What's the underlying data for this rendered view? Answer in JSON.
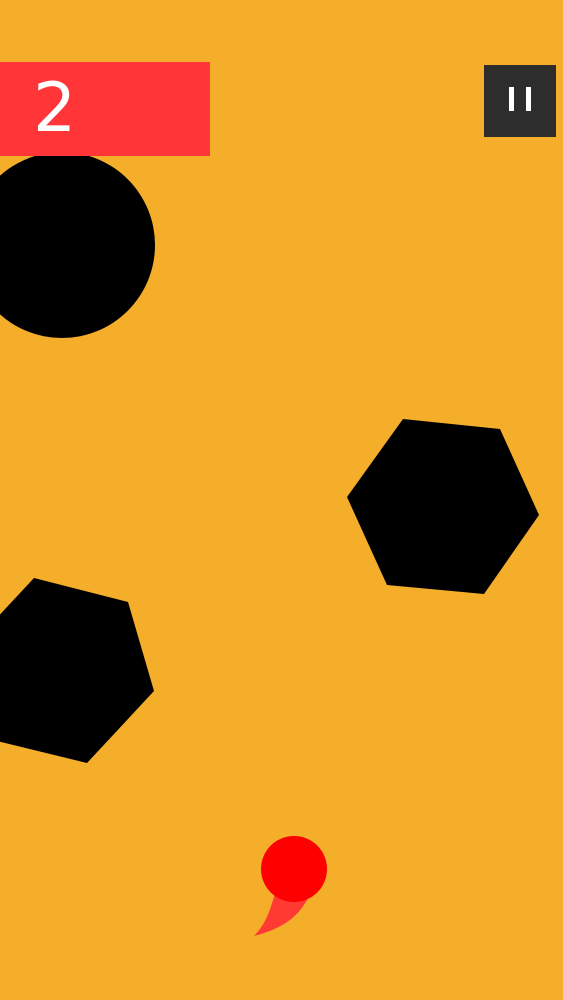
{
  "game": {
    "background_color": "#F4AE2A",
    "obstacle_color": "#000000"
  },
  "hud": {
    "score": "2",
    "score_panel_color": "#FF3537",
    "pause_button": {
      "icon": "pause-icon",
      "color": "#2D2D2D"
    }
  },
  "player": {
    "color": "#FF0000",
    "trail_color": "#FF3A33"
  },
  "obstacles": [
    {
      "shape": "circle"
    },
    {
      "shape": "hexagon"
    },
    {
      "shape": "hexagon"
    }
  ]
}
